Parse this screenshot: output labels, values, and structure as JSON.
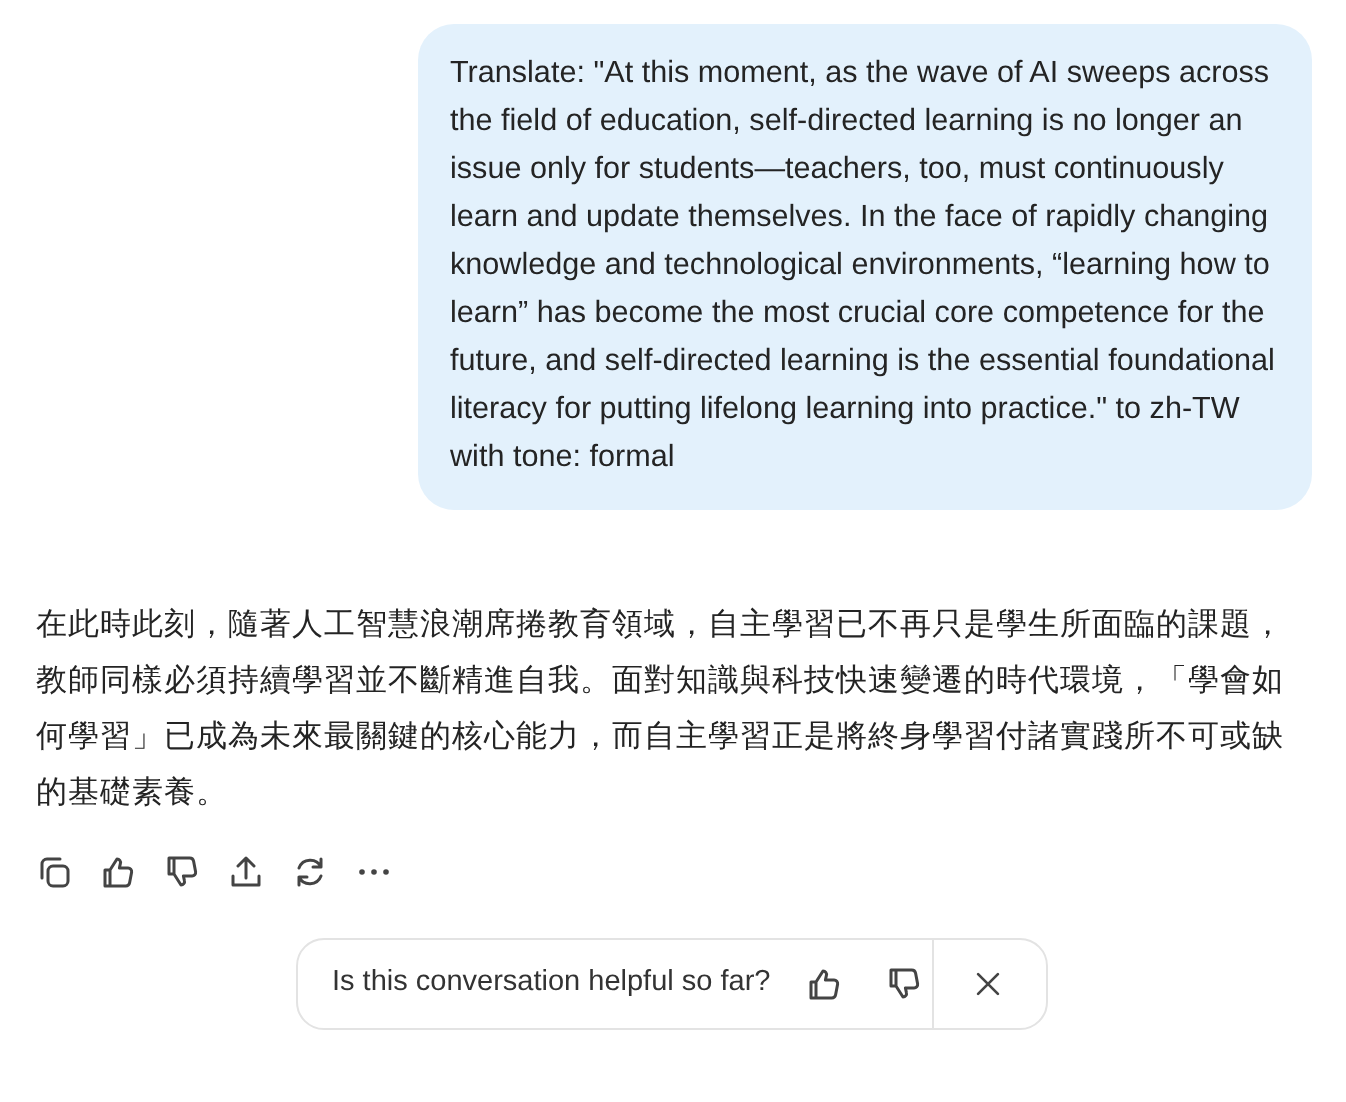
{
  "user_message": {
    "text": "Translate: \"At this moment, as the wave of AI sweeps across the field of education, self-directed learning is no longer an issue only for students—teachers, too, must continuously learn and update themselves. In the face of rapidly changing knowledge and technological environments, “learning how to learn” has become the most crucial core competence for the future, and self-directed learning is the essential foundational literacy for putting lifelong learning into practice.\" to zh-TW with tone: formal"
  },
  "assistant_message": {
    "text": "在此時此刻，隨著人工智慧浪潮席捲教育領域，自主學習已不再只是學生所面臨的課題，教師同樣必須持續學習並不斷精進自我。面對知識與科技快速變遷的時代環境，「學會如何學習」已成為未來最關鍵的核心能力，而自主學習正是將終身學習付諸實踐所不可或缺的基礎素養。"
  },
  "message_actions": [
    {
      "kind": "copy"
    },
    {
      "kind": "like"
    },
    {
      "kind": "dislike"
    },
    {
      "kind": "share"
    },
    {
      "kind": "regenerate"
    },
    {
      "kind": "more"
    }
  ],
  "feedback_bar": {
    "question": "Is this conversation helpful so far?",
    "actions": [
      {
        "kind": "like"
      },
      {
        "kind": "dislike"
      }
    ],
    "close": {
      "kind": "close"
    }
  }
}
